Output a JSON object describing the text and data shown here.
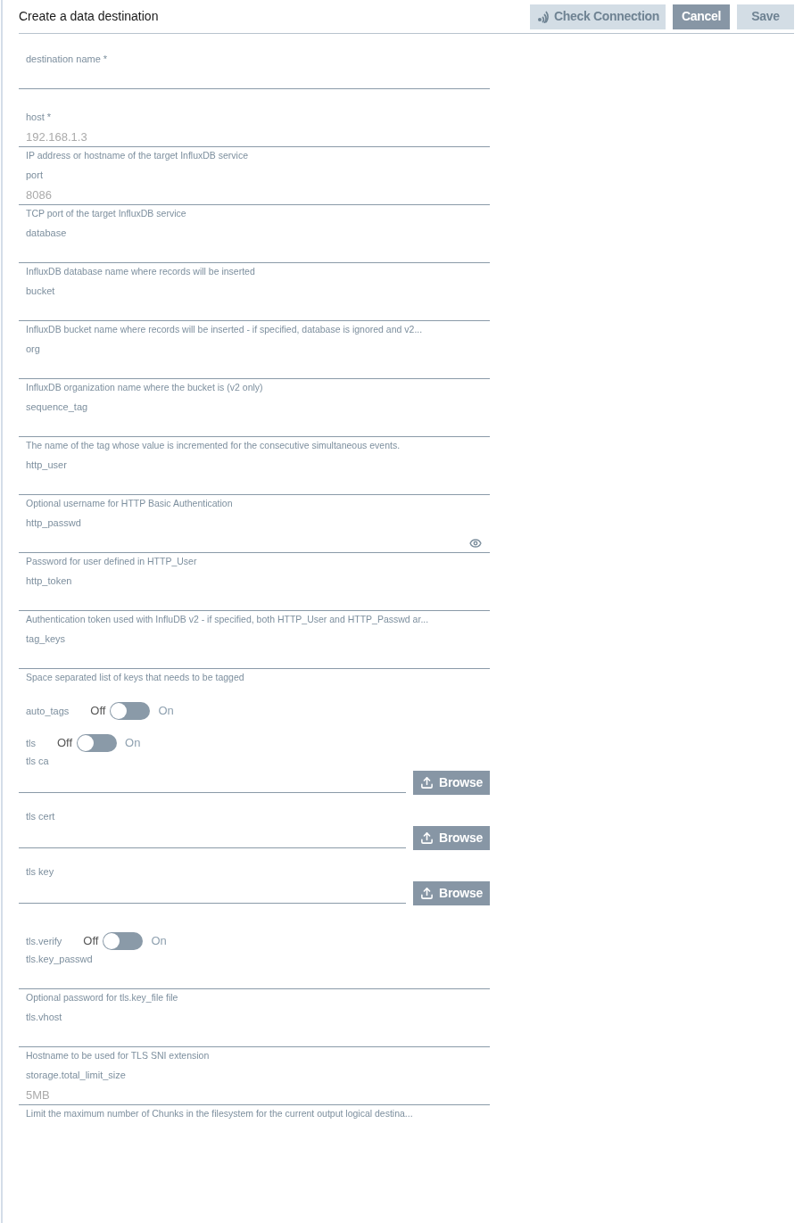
{
  "header": {
    "title": "Create a data destination",
    "buttons": [
      {
        "kind": "check",
        "label": "Check Connection",
        "disabled": true
      },
      {
        "kind": "cancel",
        "label": "Cancel",
        "disabled": false
      },
      {
        "kind": "save",
        "label": "Save",
        "disabled": true
      }
    ]
  },
  "fields": [
    {
      "kind": "text",
      "label": "destination name *"
    },
    {
      "kind": "text",
      "label": "host *",
      "placeholder": "192.168.1.3",
      "hint": "IP address or hostname of the target InfluxDB service"
    },
    {
      "kind": "text",
      "label": "port",
      "placeholder": "8086",
      "hint": "TCP port of the target InfluxDB service"
    },
    {
      "kind": "text",
      "label": "database",
      "hint": "InfluxDB database name where records will be inserted"
    },
    {
      "kind": "text",
      "label": "bucket",
      "hint": "InfluxDB bucket name where records will be inserted - if specified, database is ignored and v2..."
    },
    {
      "kind": "text",
      "label": "org",
      "hint": "InfluxDB organization name where the bucket is (v2 only)"
    },
    {
      "kind": "text",
      "label": "sequence_tag",
      "hint": "The name of the tag whose value is incremented for the consecutive simultaneous events."
    },
    {
      "kind": "text",
      "label": "http_user",
      "hint": "Optional username for HTTP Basic Authentication"
    },
    {
      "kind": "text",
      "label": "http_passwd",
      "password": true,
      "hint": "Password for user defined in HTTP_User"
    },
    {
      "kind": "text",
      "label": "http_token",
      "hint": "Authentication token used with InfluDB v2 - if specified, both HTTP_User and HTTP_Passwd ar..."
    },
    {
      "kind": "text",
      "label": "tag_keys",
      "hint": "Space separated list of keys that needs to be tagged"
    },
    {
      "kind": "toggle",
      "label": "auto_tags",
      "off_label": "Off",
      "on_label": "On",
      "on": false
    },
    {
      "kind": "toggle",
      "label": "tls",
      "off_label": "Off",
      "on_label": "On",
      "on": false
    },
    {
      "kind": "file",
      "label": "tls ca",
      "button": "Browse"
    },
    {
      "kind": "file",
      "label": "tls cert",
      "button": "Browse"
    },
    {
      "kind": "file",
      "label": "tls key",
      "button": "Browse"
    },
    {
      "kind": "toggle",
      "label": "tls.verify",
      "off_label": "Off",
      "on_label": "On",
      "on": false
    },
    {
      "kind": "text",
      "label": "tls.key_passwd",
      "hint": "Optional password for tls.key_file file"
    },
    {
      "kind": "text",
      "label": "tls.vhost",
      "hint": "Hostname to be used for TLS SNI extension"
    },
    {
      "kind": "text",
      "label": "storage.total_limit_size",
      "placeholder": "5MB",
      "hint": "Limit the maximum number of Chunks in the filesystem for the current output logical destina..."
    }
  ]
}
